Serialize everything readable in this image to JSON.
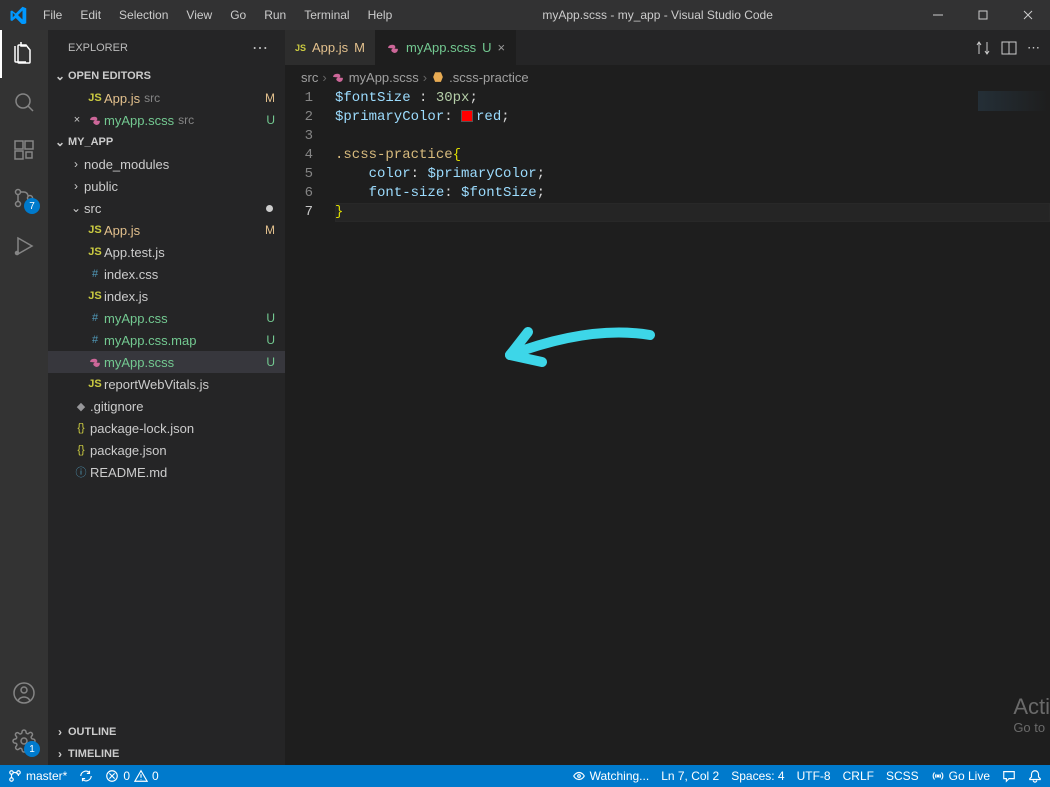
{
  "titlebar": {
    "title": "myApp.scss - my_app - Visual Studio Code",
    "menu": [
      "File",
      "Edit",
      "Selection",
      "View",
      "Go",
      "Run",
      "Terminal",
      "Help"
    ]
  },
  "activity": {
    "scm_badge": "7",
    "settings_badge": "1"
  },
  "sidebar": {
    "title": "EXPLORER",
    "openEditors": {
      "label": "OPEN EDITORS",
      "items": [
        {
          "name": "App.js",
          "dir": "src",
          "icon": "js",
          "status": "M",
          "statusClass": "st-m",
          "color": "u-amber"
        },
        {
          "name": "myApp.scss",
          "dir": "src",
          "icon": "sass",
          "status": "U",
          "statusClass": "st-u",
          "color": "u-green",
          "close": true
        }
      ]
    },
    "project": {
      "label": "MY_APP",
      "tree": [
        {
          "indent": 1,
          "chev": "›",
          "name": "node_modules",
          "type": "folder"
        },
        {
          "indent": 1,
          "chev": "›",
          "name": "public",
          "type": "folder"
        },
        {
          "indent": 1,
          "chev": "⌄",
          "name": "src",
          "type": "folder",
          "modifiedDot": true
        },
        {
          "indent": 2,
          "name": "App.js",
          "icon": "js",
          "color": "u-amber",
          "status": "M",
          "statusClass": "st-m"
        },
        {
          "indent": 2,
          "name": "App.test.js",
          "icon": "js"
        },
        {
          "indent": 2,
          "name": "index.css",
          "icon": "css"
        },
        {
          "indent": 2,
          "name": "index.js",
          "icon": "js"
        },
        {
          "indent": 2,
          "name": "myApp.css",
          "icon": "css",
          "color": "u-green",
          "status": "U",
          "statusClass": "st-u"
        },
        {
          "indent": 2,
          "name": "myApp.css.map",
          "icon": "css",
          "color": "u-green",
          "status": "U",
          "statusClass": "st-u"
        },
        {
          "indent": 2,
          "name": "myApp.scss",
          "icon": "sass",
          "color": "u-green",
          "status": "U",
          "statusClass": "st-u",
          "selected": true
        },
        {
          "indent": 2,
          "name": "reportWebVitals.js",
          "icon": "js"
        },
        {
          "indent": 1,
          "name": ".gitignore",
          "icon": "git"
        },
        {
          "indent": 1,
          "name": "package-lock.json",
          "icon": "json"
        },
        {
          "indent": 1,
          "name": "package.json",
          "icon": "json"
        },
        {
          "indent": 1,
          "name": "README.md",
          "icon": "info"
        }
      ]
    },
    "outline": "OUTLINE",
    "timeline": "TIMELINE"
  },
  "tabs": [
    {
      "name": "App.js",
      "icon": "js",
      "status": "M",
      "statusClass": "st-m",
      "color": "u-amber"
    },
    {
      "name": "myApp.scss",
      "icon": "sass",
      "status": "U",
      "statusClass": "st-u",
      "color": "u-green",
      "active": true,
      "close": true
    }
  ],
  "breadcrumb": [
    "src",
    "myApp.scss",
    ".scss-practice"
  ],
  "code": {
    "lines": [
      {
        "n": 1,
        "html": "<span class='tok-var'>$fontSize</span> <span class='tok-punc'>:</span> <span class='tok-num'>30</span><span class='tok-unit'>px</span><span class='tok-punc'>;</span>"
      },
      {
        "n": 2,
        "html": "<span class='tok-var'>$primaryColor</span><span class='tok-punc'>:</span> <span class='color-swatch' style='background:#ff0000'></span><span class='tok-var'>red</span><span class='tok-punc'>;</span>"
      },
      {
        "n": 3,
        "html": ""
      },
      {
        "n": 4,
        "html": "<span class='tok-sel'>.scss-practice</span><span class='tok-brace'>{</span>"
      },
      {
        "n": 5,
        "html": "    <span class='tok-prop'>color</span><span class='tok-punc'>:</span> <span class='tok-var'>$primaryColor</span><span class='tok-punc'>;</span>"
      },
      {
        "n": 6,
        "html": "    <span class='tok-prop'>font-size</span><span class='tok-punc'>:</span> <span class='tok-var'>$fontSize</span><span class='tok-punc'>;</span>"
      },
      {
        "n": 7,
        "html": "<span class='tok-brace'>}</span>",
        "current": true
      }
    ]
  },
  "statusbar": {
    "branch": "master*",
    "sync": "⟳",
    "errors": "0",
    "warnings": "0",
    "watching": "Watching...",
    "position": "Ln 7, Col 2",
    "spaces": "Spaces: 4",
    "encoding": "UTF-8",
    "eol": "CRLF",
    "lang": "SCSS",
    "golive": "Go Live"
  },
  "watermark": {
    "l1": "Acti",
    "l2": "Go to"
  }
}
